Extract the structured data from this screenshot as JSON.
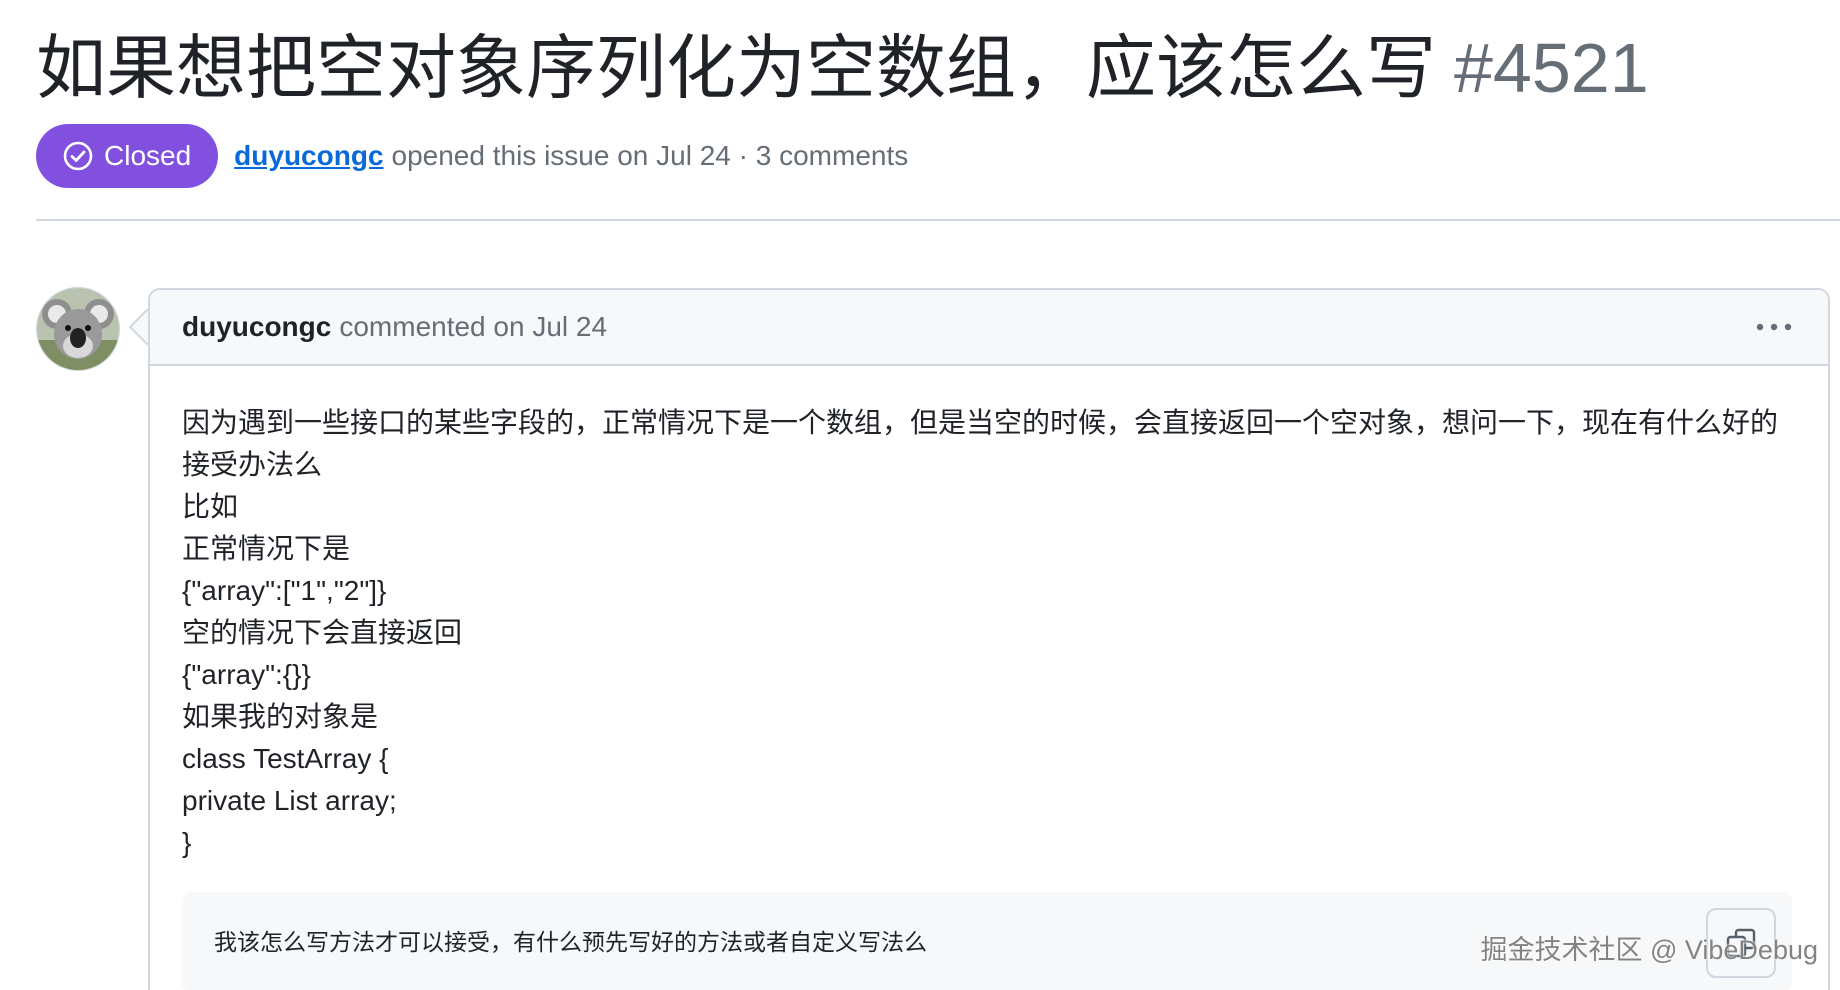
{
  "issue": {
    "title": "如果想把空对象序列化为空数组，应该怎么写",
    "number": "#4521",
    "state_label": "Closed",
    "state_color": "#8250df",
    "state_icon": "check-circle-icon",
    "author": "duyucongc",
    "opened_text": "opened this issue on Jul 24 · 3 comments"
  },
  "comment": {
    "author": "duyucongc",
    "header_suffix": "commented on Jul 24",
    "menu_icon": "kebab-horizontal-icon",
    "avatar_icon": "koala-avatar",
    "body_lines": [
      "因为遇到一些接口的某些字段的，正常情况下是一个数组，但是当空的时候，会直接返回一个空对象，想问一下，现在有什么好的",
      "接受办法么",
      "比如",
      "正常情况下是",
      "{\"array\":[\"1\",\"2\"]}",
      "空的情况下会直接返回",
      "{\"array\":{}}",
      "如果我的对象是",
      "class TestArray {",
      "private List array;",
      "}"
    ],
    "code_block_text": "我该怎么写方法才可以接受，有什么预先写好的方法或者自定义写法么",
    "copy_icon": "copy-icon"
  },
  "watermark": "掘金技术社区 @ VibeDebug",
  "colors": {
    "link": "#0969da",
    "muted": "#656d76",
    "border": "#d0d7de",
    "subtle_bg": "#f6f8fa"
  }
}
